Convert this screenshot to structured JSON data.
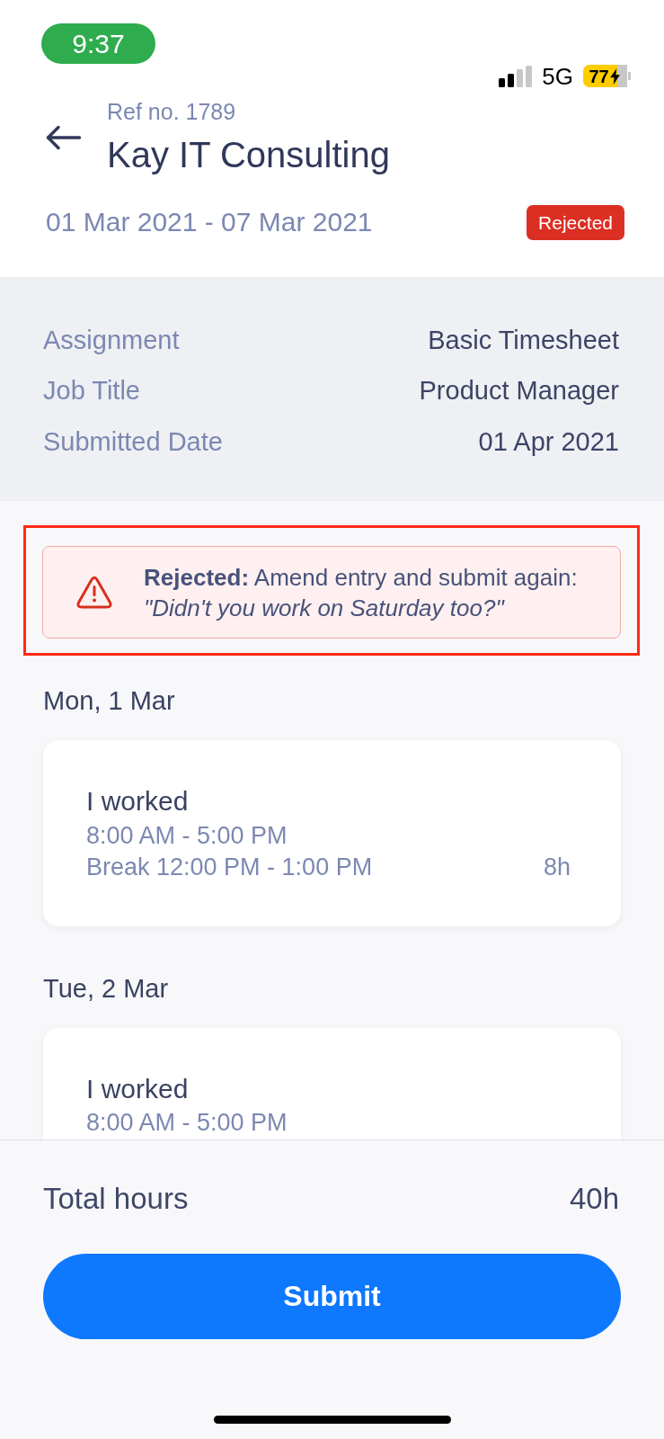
{
  "status_bar": {
    "time": "9:37",
    "network": "5G",
    "battery": "77"
  },
  "header": {
    "ref": "Ref no. 1789",
    "title": "Kay IT Consulting",
    "period": "01 Mar 2021 - 07 Mar 2021",
    "status": {
      "label": "Rejected",
      "kind": "rejected"
    }
  },
  "details": [
    {
      "label": "Assignment",
      "value": "Basic Timesheet"
    },
    {
      "label": "Job Title",
      "value": "Product Manager"
    },
    {
      "label": "Submitted Date",
      "value": "01 Apr 2021"
    }
  ],
  "alert": {
    "kind": "error",
    "highlighted": true,
    "text": "**Rejected:** Amend entry and submit again: *\"Didn't you work on Saturday too?\"*"
  },
  "days": [
    {
      "date": "Mon, 1 Mar",
      "entries": [
        {
          "title": "I worked",
          "time": "8:00 AM - 5:00 PM",
          "break": "Break 12:00 PM - 1:00 PM",
          "hours": "8h"
        }
      ]
    },
    {
      "date": "Tue, 2 Mar",
      "entries": [
        {
          "title": "I worked",
          "time": "8:00 AM - 5:00 PM"
        }
      ]
    }
  ],
  "footer": {
    "total_label": "Total hours",
    "total_value": "40h",
    "button": "Submit"
  }
}
